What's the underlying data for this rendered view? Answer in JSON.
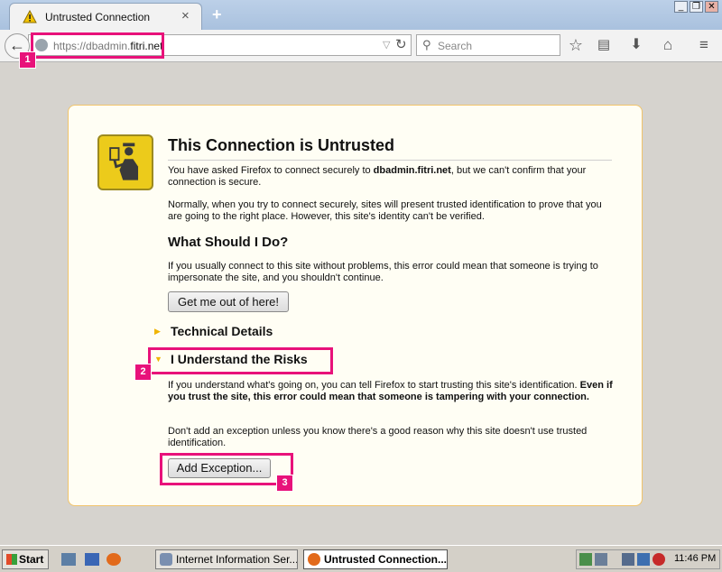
{
  "browser": {
    "tab_title": "Untrusted Connection",
    "tab_close": "×",
    "new_tab": "+",
    "url_prefix": "https://dbadmin.",
    "url_domain": "fitri.net",
    "search_placeholder": "Search",
    "window_controls": [
      "_",
      "❐",
      "✕"
    ]
  },
  "page": {
    "title": "This Connection is Untrusted",
    "intro_before": "You have asked Firefox to connect securely to ",
    "intro_host": "dbadmin.fitri.net",
    "intro_after": ", but we can't confirm that your connection is secure.",
    "normally": "Normally, when you try to connect securely, sites will present trusted identification to prove that you are going to the right place. However, this site's identity can't be verified.",
    "what_heading": "What Should I Do?",
    "what_text": "If you usually connect to this site without problems, this error could mean that someone is trying to impersonate the site, and you shouldn't continue.",
    "get_out_button": "Get me out of here!",
    "technical_details": "Technical Details",
    "understand_risks": "I Understand the Risks",
    "risks_text_plain": "If you understand what's going on, you can tell Firefox to start trusting this site's identification. ",
    "risks_text_bold": "Even if you trust the site, this error could mean that someone is tampering with your connection.",
    "dont_add": "Don't add an exception unless you know there's a good reason why this site doesn't use trusted identification.",
    "add_exception_button": "Add Exception..."
  },
  "annotations": [
    "1",
    "2",
    "3"
  ],
  "taskbar": {
    "start_label": "Start",
    "tasks": [
      "Internet Information Ser...",
      "Untrusted Connection..."
    ],
    "clock": "11:46 PM"
  },
  "colors": {
    "callout": "#e8127a",
    "error_box_border": "#f1c46b",
    "error_box_bg": "#fffef4"
  }
}
